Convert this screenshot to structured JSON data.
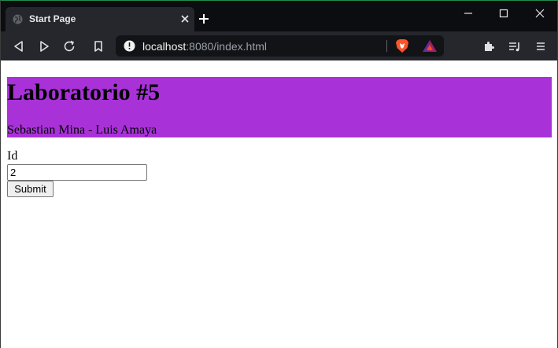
{
  "browser": {
    "tab": {
      "title": "Start Page"
    },
    "address": {
      "host": "localhost",
      "path": ":8080/index.html"
    },
    "icons": {
      "favicon": "globe-icon",
      "tab_close": "close-icon",
      "new_tab": "plus-icon",
      "minimize": "minimize-icon",
      "maximize": "maximize-icon",
      "close_window": "close-icon",
      "back": "back-icon",
      "forward": "forward-icon",
      "reload": "reload-icon",
      "bookmark": "bookmark-icon",
      "site_info": "info-icon",
      "brave_shields": "brave-lion-icon",
      "rewards": "bat-triangle-icon",
      "extensions": "puzzle-icon",
      "playlist": "playlist-icon",
      "menu": "hamburger-icon"
    },
    "colors": {
      "frame": "#0c0d10",
      "toolbar": "#25272c",
      "urlbar": "#121317",
      "accent": "#1f8f4e"
    }
  },
  "page": {
    "heading": "Laboratorio #5",
    "authors": "Sebastian Mina - Luis Amaya",
    "banner_color": "#a832d8",
    "form": {
      "id_label": "Id",
      "id_value": "2",
      "submit_label": "Submit"
    }
  }
}
